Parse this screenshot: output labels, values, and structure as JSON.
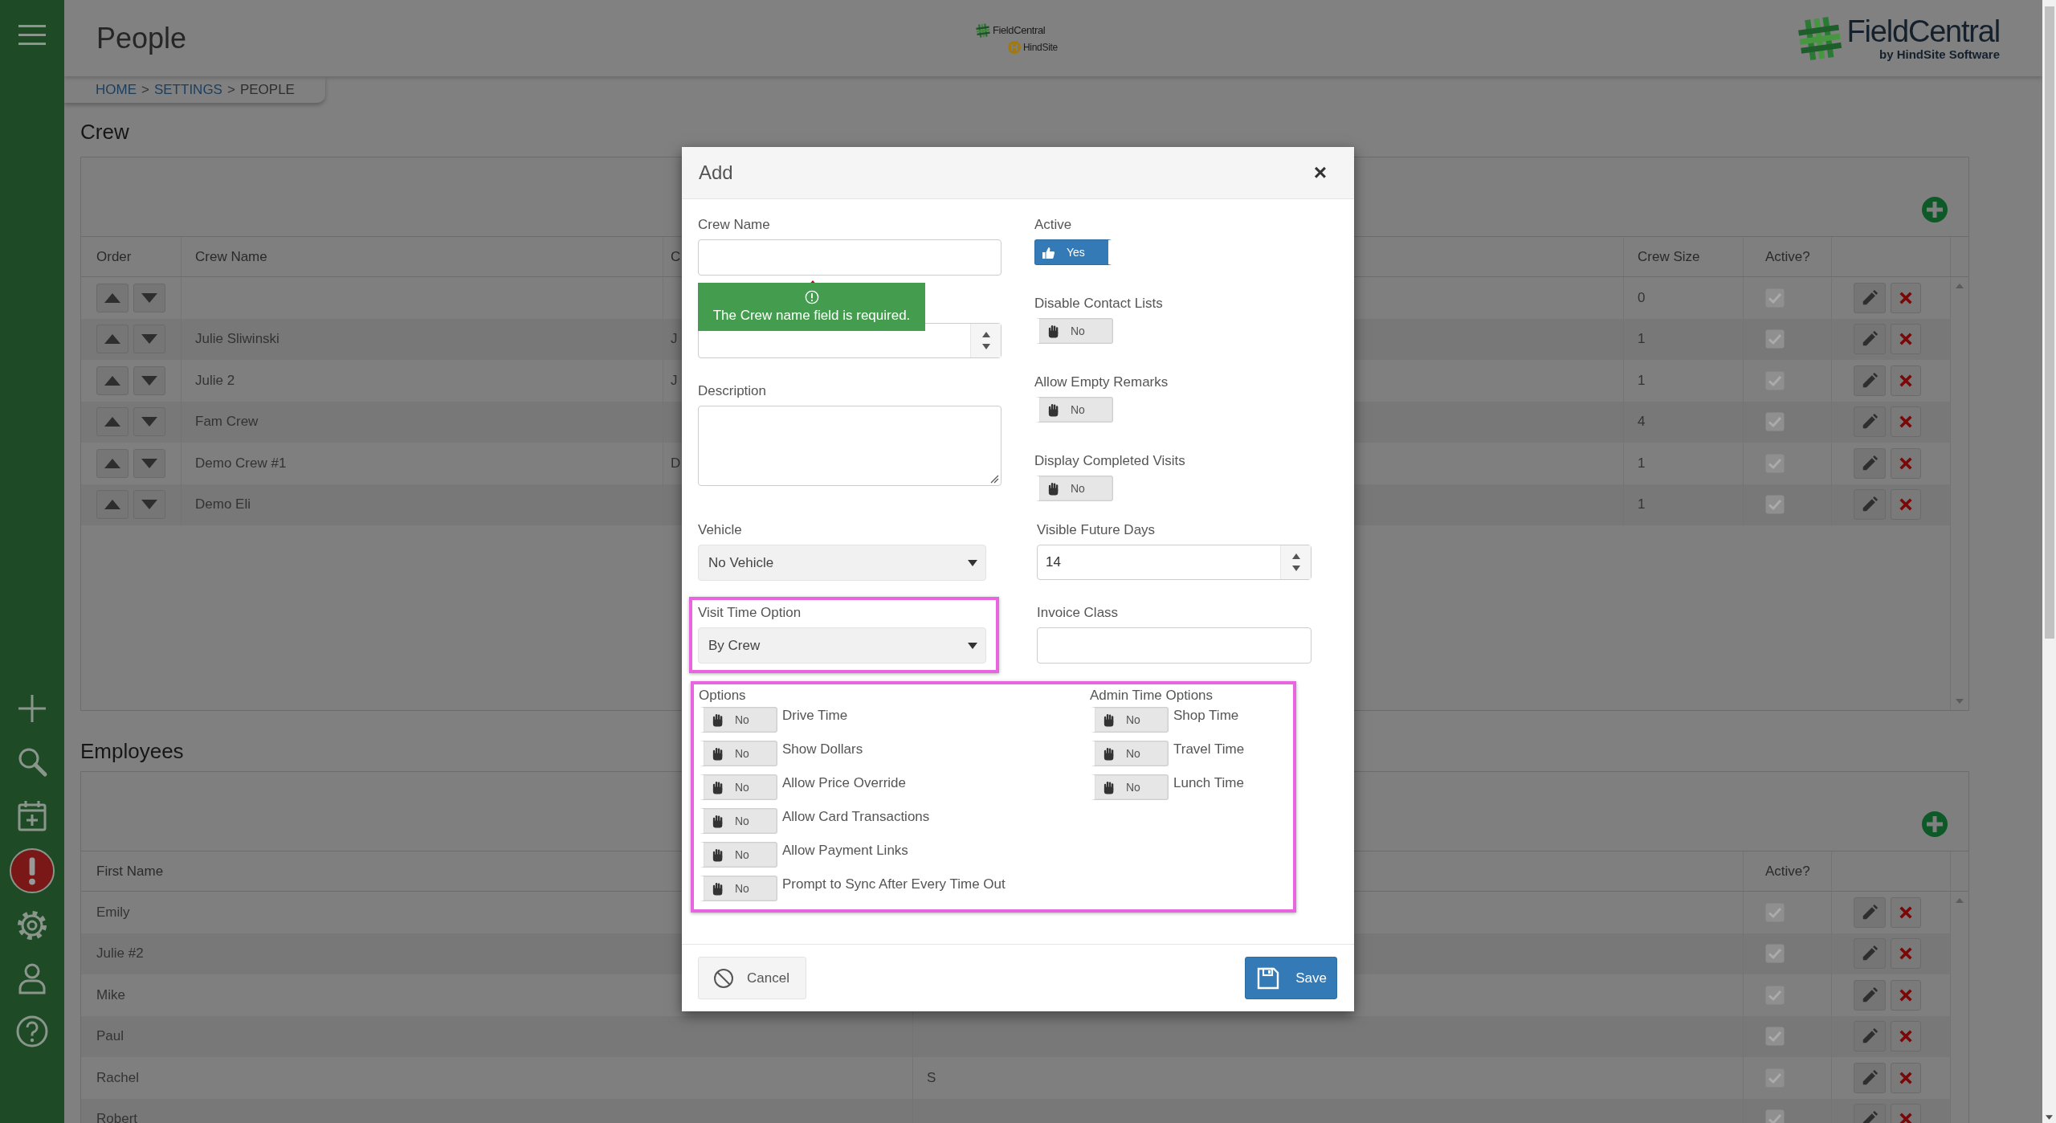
{
  "header": {
    "title": "People",
    "center_logo": {
      "name": "FieldCentral",
      "tagline": "HindSite"
    },
    "logo": {
      "name": "FieldCentral",
      "tagline": "by HindSite Software"
    }
  },
  "breadcrumb": [
    {
      "kind": "link",
      "label": "HOME"
    },
    {
      "kind": "separator",
      "label": ">"
    },
    {
      "kind": "link",
      "label": "SETTINGS"
    },
    {
      "kind": "separator",
      "label": ">"
    },
    {
      "kind": "current",
      "label": "PEOPLE"
    }
  ],
  "crew": {
    "title": "Crew",
    "columns": [
      "Order",
      "Crew Name",
      "C",
      "Crew Size",
      "Active?"
    ],
    "rows": [
      {
        "crew_size": "0",
        "active": true
      },
      {
        "name": "Julie Sliwinski",
        "column_3": "J",
        "crew_size": "1",
        "active": true
      },
      {
        "name": "Julie 2",
        "column_3": "J",
        "crew_size": "1",
        "active": true
      },
      {
        "name": "Fam Crew",
        "crew_size": "4",
        "active": true
      },
      {
        "name": "Demo Crew #1",
        "column_3": "D",
        "crew_size": "1",
        "active": true
      },
      {
        "name": "Demo Eli",
        "crew_size": "1",
        "active": true
      }
    ]
  },
  "employees": {
    "title": "Employees",
    "columns": [
      "First Name",
      "Active?"
    ],
    "rows": [
      {
        "first_name": "Emily",
        "active": true
      },
      {
        "first_name": "Julie #2",
        "active": true
      },
      {
        "first_name": "Mike",
        "active": true
      },
      {
        "first_name": "Paul",
        "active": true
      },
      {
        "first_name": "Rachel",
        "column_2": "S",
        "active": true
      },
      {
        "first_name": "Robert",
        "active": true
      }
    ]
  },
  "dialog": {
    "title": "Add",
    "close": "×",
    "left": [
      {
        "kind": "text",
        "label": "Crew Name",
        "error": "The Crew name field is required."
      },
      {
        "kind": "number"
      },
      {
        "kind": "textarea",
        "label": "Description"
      }
    ],
    "right": [
      {
        "kind": "toggle",
        "label": "Active",
        "on": true,
        "text": "Yes"
      },
      {
        "kind": "toggle",
        "label": "Disable Contact Lists",
        "on": false,
        "text": "No"
      },
      {
        "kind": "toggle",
        "label": "Allow Empty Remarks",
        "on": false,
        "text": "No"
      },
      {
        "kind": "toggle",
        "label": "Display Completed Visits",
        "on": false,
        "text": "No"
      }
    ],
    "rows": [
      [
        {
          "kind": "select",
          "label": "Vehicle",
          "value": "No Vehicle"
        },
        {
          "kind": "number",
          "label": "Visible Future Days",
          "value": "14"
        }
      ],
      [
        {
          "kind": "select",
          "label": "Visit Time Option",
          "value": "By Crew",
          "highlighted": true
        },
        {
          "kind": "text",
          "label": "Invoice Class"
        }
      ]
    ],
    "option_groups": {
      "highlighted": true,
      "groups": [
        {
          "title": "Options",
          "items": [
            {
              "label": "Drive Time",
              "on": false,
              "text": "No"
            },
            {
              "label": "Show Dollars",
              "on": false,
              "text": "No"
            },
            {
              "label": "Allow Price Override",
              "on": false,
              "text": "No"
            },
            {
              "label": "Allow Card Transactions",
              "on": false,
              "text": "No"
            },
            {
              "label": "Allow Payment Links",
              "on": false,
              "text": "No"
            },
            {
              "label": "Prompt to Sync After Every Time Out",
              "on": false,
              "text": "No"
            }
          ]
        },
        {
          "title": "Admin Time Options",
          "items": [
            {
              "label": "Shop Time",
              "on": false,
              "text": "No"
            },
            {
              "label": "Travel Time",
              "on": false,
              "text": "No"
            },
            {
              "label": "Lunch Time",
              "on": false,
              "text": "No"
            }
          ]
        }
      ]
    },
    "buttons": [
      {
        "kind": "cancel",
        "label": "Cancel"
      },
      {
        "kind": "save",
        "label": "Save"
      }
    ]
  }
}
